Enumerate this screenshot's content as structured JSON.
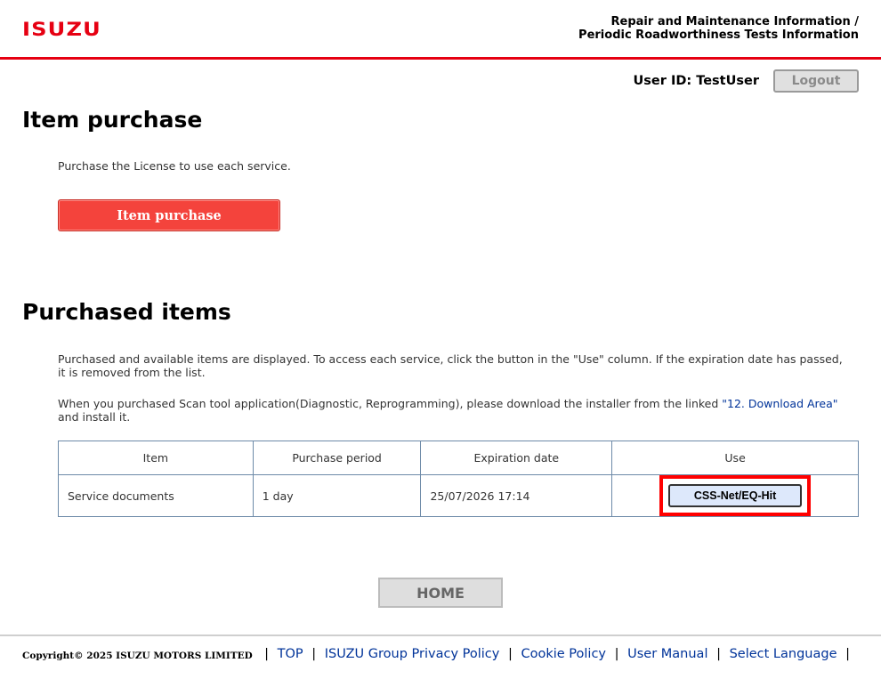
{
  "header": {
    "logo": "ISUZU",
    "title_line1": "Repair and Maintenance Information /",
    "title_line2": "Periodic Roadworthiness Tests Information"
  },
  "user": {
    "id_label": "User ID: TestUser",
    "logout_label": "Logout"
  },
  "purchase_section": {
    "heading": "Item purchase",
    "description": "Purchase the License to use each service.",
    "button_label": "Item purchase"
  },
  "purchased_section": {
    "heading": "Purchased items",
    "description": "Purchased and available items are displayed. To access each service, click the button in the \"Use\" column. If the expiration date has passed, it is removed from the list.",
    "note_prefix": "When you purchased Scan tool application(Diagnostic, Reprogramming), please download the installer from the linked ",
    "note_link": "\"12. Download Area\"",
    "note_suffix": " and install it.",
    "table": {
      "headers": [
        "Item",
        "Purchase period",
        "Expiration date",
        "Use"
      ],
      "rows": [
        {
          "item": "Service documents",
          "period": "1 day",
          "expiration": "25/07/2026 17:14",
          "use_label": "CSS-Net/EQ-Hit"
        }
      ]
    }
  },
  "home_label": "HOME",
  "footer": {
    "copyright": "Copyright© 2025 ISUZU MOTORS LIMITED",
    "separator": "|",
    "links": [
      "TOP",
      "ISUZU Group Privacy Policy",
      "Cookie Policy",
      "User Manual",
      "Select Language"
    ]
  },
  "colors": {
    "brand_red": "#e60012",
    "purchase_button": "#f4433c",
    "link_blue": "#003399",
    "highlight_border": "#ff0000"
  }
}
